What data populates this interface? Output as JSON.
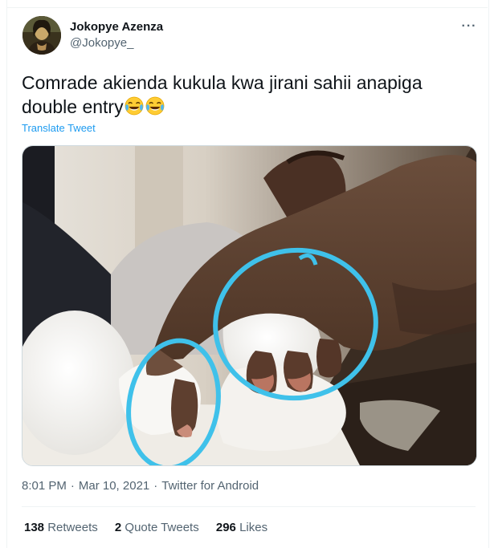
{
  "author": {
    "display_name": "Jokopye Azenza",
    "handle": "@Jokopye_"
  },
  "tweet": {
    "text": "Comrade akienda kukula kwa jirani sahii anapiga double entry",
    "emojis": [
      "face-with-tears-of-joy",
      "face-with-tears-of-joy"
    ],
    "translate_label": "Translate Tweet"
  },
  "meta": {
    "time": "8:01 PM",
    "separator": "·",
    "date": "Mar 10, 2021",
    "source": "Twitter for Android"
  },
  "stats": {
    "retweets_count": "138",
    "retweets_label": "Retweets",
    "quotes_count": "2",
    "quotes_label": "Quote Tweets",
    "likes_count": "296",
    "likes_label": "Likes"
  },
  "icons": {
    "more": "more-horizontal-icon"
  },
  "colors": {
    "link": "#1d9bf0",
    "secondary_text": "#536471",
    "circle_highlight": "#3fc1ea"
  }
}
